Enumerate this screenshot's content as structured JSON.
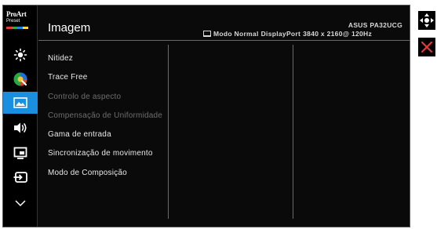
{
  "logo": {
    "line1": "ProArt",
    "line2": "Preset"
  },
  "sidebar": {
    "items": [
      {
        "icon": "brightness-sun-icon",
        "active": false
      },
      {
        "icon": "color-palette-icon",
        "active": false
      },
      {
        "icon": "image-icon",
        "active": true
      },
      {
        "icon": "speaker-icon",
        "active": false
      },
      {
        "icon": "pip-icon",
        "active": false
      },
      {
        "icon": "input-select-icon",
        "active": false
      },
      {
        "icon": "chevron-down-icon",
        "active": false
      }
    ]
  },
  "header": {
    "title": "Imagem",
    "model": "ASUS PA32UCG",
    "mode": "Modo Normal",
    "input": "DisplayPort",
    "resolution": "3840 x 2160@  120Hz"
  },
  "menu": {
    "items": [
      {
        "label": "Nitidez",
        "enabled": true
      },
      {
        "label": "Trace Free",
        "enabled": true
      },
      {
        "label": "Controlo de aspecto",
        "enabled": false
      },
      {
        "label": "Compensação de Uniformidade",
        "enabled": false
      },
      {
        "label": "Gama de entrada",
        "enabled": true
      },
      {
        "label": "Sincronização de movimento",
        "enabled": true
      },
      {
        "label": "Modo de Composição",
        "enabled": true
      }
    ]
  },
  "controls": {
    "move_icon": "four-way-arrow-icon",
    "close_icon": "close-icon"
  },
  "colors": {
    "accent": "#1a8fe0",
    "close": "#e53935"
  }
}
